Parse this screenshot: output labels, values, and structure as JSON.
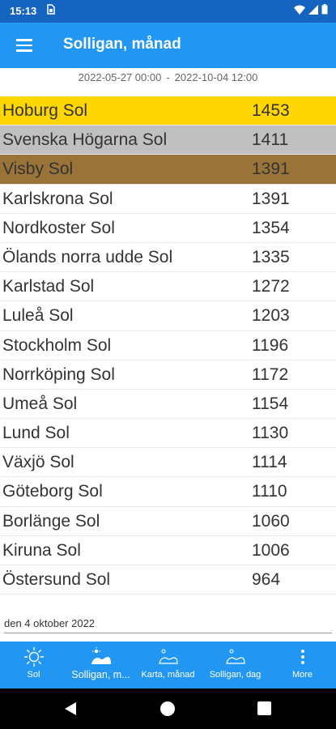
{
  "status_bar": {
    "time": "15:13",
    "sim_icon": "sim-card-icon"
  },
  "app_bar": {
    "title": "Solligan, månad"
  },
  "range": {
    "from": "2022-05-27 00:00",
    "separator": "-",
    "to": "2022-10-04 12:00"
  },
  "list": [
    {
      "name": "Hoburg Sol",
      "value": "1453"
    },
    {
      "name": "Svenska Högarna Sol",
      "value": "1411"
    },
    {
      "name": "Visby Sol",
      "value": "1391"
    },
    {
      "name": "Karlskrona Sol",
      "value": "1391"
    },
    {
      "name": "Nordkoster Sol",
      "value": "1354"
    },
    {
      "name": "Ölands norra udde Sol",
      "value": "1335"
    },
    {
      "name": "Karlstad Sol",
      "value": "1272"
    },
    {
      "name": "Luleå Sol",
      "value": "1203"
    },
    {
      "name": "Stockholm Sol",
      "value": "1196"
    },
    {
      "name": "Norrköping Sol",
      "value": "1172"
    },
    {
      "name": "Umeå Sol",
      "value": "1154"
    },
    {
      "name": "Lund Sol",
      "value": "1130"
    },
    {
      "name": "Växjö Sol",
      "value": "1114"
    },
    {
      "name": "Göteborg Sol",
      "value": "1110"
    },
    {
      "name": "Borlänge Sol",
      "value": "1060"
    },
    {
      "name": "Kiruna Sol",
      "value": "1006"
    },
    {
      "name": "Östersund Sol",
      "value": "964"
    }
  ],
  "highlight_colors": {
    "gold": "#ffd700",
    "silver": "#c0c0c0",
    "bronze": "#9a7338"
  },
  "footer": {
    "date": "den 4 oktober 2022"
  },
  "bottom_nav": {
    "items": [
      {
        "label": "Sol",
        "icon": "sun-icon"
      },
      {
        "label": "Solligan, m...",
        "icon": "sun-ranking-icon"
      },
      {
        "label": "Karta, månad",
        "icon": "sun-map-icon"
      },
      {
        "label": "Solligan, dag",
        "icon": "sun-ranking-day-icon"
      },
      {
        "label": "More",
        "icon": "more-vertical-icon"
      }
    ]
  },
  "colors": {
    "status_bar": "#1565c0",
    "app_bar": "#2196f3",
    "bottom_nav": "#2196f3"
  }
}
